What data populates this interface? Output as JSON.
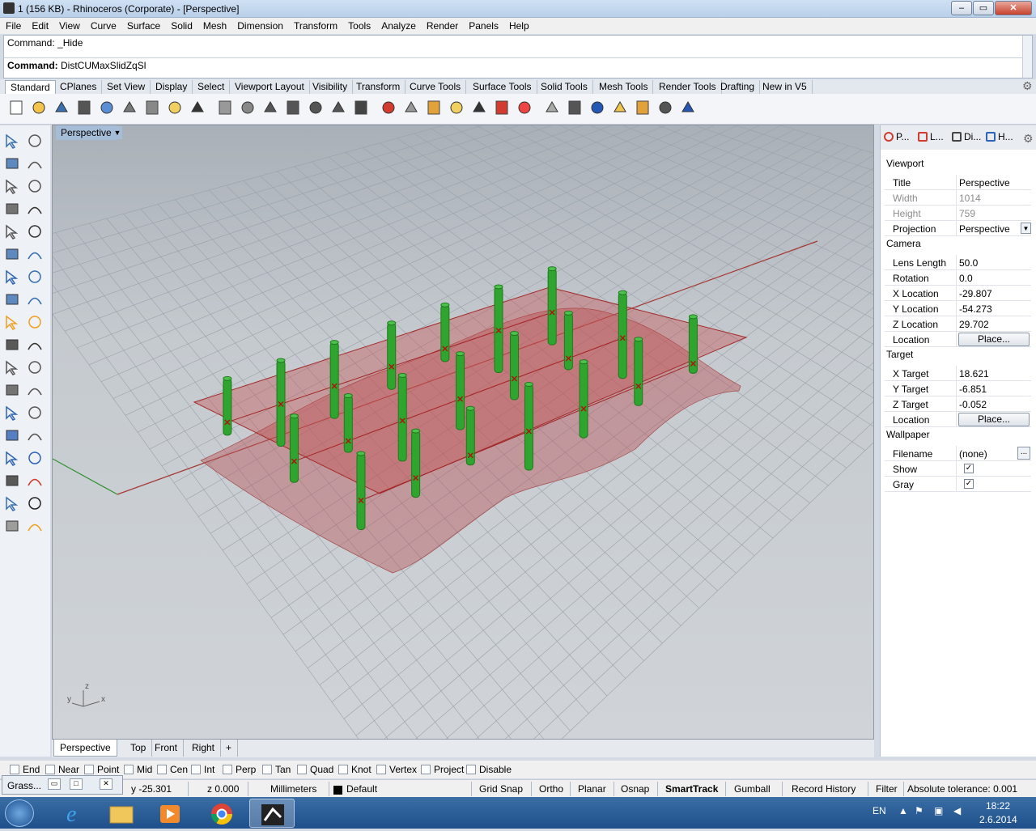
{
  "window": {
    "title": "1 (156 KB) - Rhinoceros (Corporate) - [Perspective]",
    "min": "–",
    "max": "▭",
    "close": "✕"
  },
  "menu": [
    "File",
    "Edit",
    "View",
    "Curve",
    "Surface",
    "Solid",
    "Mesh",
    "Dimension",
    "Transform",
    "Tools",
    "Analyze",
    "Render",
    "Panels",
    "Help"
  ],
  "command": {
    "history": "Command: _Hide",
    "prompt_label": "Command:",
    "prompt_value": "DistCUMaxSlidZqSl"
  },
  "toolbar_tabs": [
    "Standard",
    "CPlanes",
    "Set View",
    "Display",
    "Select",
    "Viewport Layout",
    "Visibility",
    "Transform",
    "Curve Tools",
    "Surface Tools",
    "Solid Tools",
    "Mesh Tools",
    "Render Tools",
    "Drafting",
    "New in V5"
  ],
  "standard_tools": [
    "new-icon",
    "open-icon",
    "save-icon",
    "print-icon",
    "import-icon",
    "cut-icon",
    "copy-icon",
    "paste-icon",
    "undo-icon",
    "pan-icon",
    "rotate-view-icon",
    "zoom-dynamic-icon",
    "zoom-window-icon",
    "zoom-extents-icon",
    "zoom-selected-icon",
    "viewport-layout-icon",
    "car-icon",
    "shade-icon",
    "cplane-icon",
    "lights-icon",
    "lock-icon",
    "layer-icon",
    "color-wheel-icon",
    "render-icon",
    "material-icon",
    "sphere-icon",
    "osnap-icon",
    "options-icon",
    "select-icon",
    "help-icon"
  ],
  "viewport": {
    "name": "Perspective",
    "axis_x": "x",
    "axis_y": "y",
    "axis_z": "z"
  },
  "view_tabs": [
    "Perspective",
    "Top",
    "Front",
    "Right",
    "+"
  ],
  "panel": {
    "tabs": [
      "P...",
      "L...",
      "Di...",
      "H..."
    ],
    "viewport_header": "Viewport",
    "rows_viewport": [
      {
        "label": "Title",
        "value": "Perspective",
        "grey": false
      },
      {
        "label": "Width",
        "value": "1014",
        "grey": true
      },
      {
        "label": "Height",
        "value": "759",
        "grey": true
      },
      {
        "label": "Projection",
        "value": "Perspective",
        "grey": false
      }
    ],
    "camera_header": "Camera",
    "rows_camera": [
      {
        "label": "Lens Length",
        "value": "50.0"
      },
      {
        "label": "Rotation",
        "value": "0.0"
      },
      {
        "label": "X Location",
        "value": "-29.807"
      },
      {
        "label": "Y Location",
        "value": "-54.273"
      },
      {
        "label": "Z Location",
        "value": "29.702"
      }
    ],
    "camera_location_label": "Location",
    "place_button": "Place...",
    "target_header": "Target",
    "rows_target": [
      {
        "label": "X Target",
        "value": "18.621"
      },
      {
        "label": "Y Target",
        "value": "-6.851"
      },
      {
        "label": "Z Target",
        "value": "-0.052"
      }
    ],
    "target_location_label": "Location",
    "wallpaper_header": "Wallpaper",
    "filename_label": "Filename",
    "filename_value": "(none)",
    "browse": "...",
    "show_label": "Show",
    "gray_label": "Gray",
    "show_checked": true,
    "gray_checked": true
  },
  "osnaps": [
    "End",
    "Near",
    "Point",
    "Mid",
    "Cen",
    "Int",
    "Perp",
    "Tan",
    "Quad",
    "Knot",
    "Vertex",
    "Project",
    "Disable"
  ],
  "status": {
    "y": "y -25.301",
    "z": "z 0.000",
    "units": "Millimeters",
    "layer": "Default",
    "grid_snap": "Grid Snap",
    "ortho": "Ortho",
    "planar": "Planar",
    "osnap": "Osnap",
    "smarttrack": "SmartTrack",
    "gumball": "Gumball",
    "record_history": "Record History",
    "filter": "Filter",
    "tolerance": "Absolute tolerance: 0.001"
  },
  "grasshopper": {
    "label": "Grass..."
  },
  "taskbar": {
    "lang": "EN",
    "time": "18:22",
    "date": "2.6.2014"
  },
  "colors": {
    "accent": "#a6bdd8",
    "surface": "#c0504d",
    "columns": "#2fa52f"
  }
}
